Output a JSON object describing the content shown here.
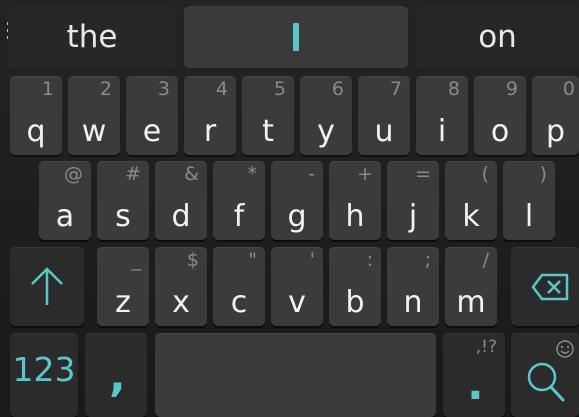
{
  "suggestions": {
    "left": "the",
    "middle": "I",
    "right": "on"
  },
  "rows": [
    {
      "keys": [
        {
          "main": "q",
          "hint": "1"
        },
        {
          "main": "w",
          "hint": "2"
        },
        {
          "main": "e",
          "hint": "3"
        },
        {
          "main": "r",
          "hint": "4"
        },
        {
          "main": "t",
          "hint": "5"
        },
        {
          "main": "y",
          "hint": "6"
        },
        {
          "main": "u",
          "hint": "7"
        },
        {
          "main": "i",
          "hint": "8"
        },
        {
          "main": "o",
          "hint": "9"
        },
        {
          "main": "p",
          "hint": "0"
        }
      ]
    },
    {
      "keys": [
        {
          "main": "a",
          "hint": "@"
        },
        {
          "main": "s",
          "hint": "#"
        },
        {
          "main": "d",
          "hint": "&"
        },
        {
          "main": "f",
          "hint": "*"
        },
        {
          "main": "g",
          "hint": "-"
        },
        {
          "main": "h",
          "hint": "+"
        },
        {
          "main": "j",
          "hint": "="
        },
        {
          "main": "k",
          "hint": "("
        },
        {
          "main": "l",
          "hint": ")"
        }
      ]
    },
    {
      "keys": [
        {
          "main": "z",
          "hint": "_"
        },
        {
          "main": "x",
          "hint": "$"
        },
        {
          "main": "c",
          "hint": "\""
        },
        {
          "main": "v",
          "hint": "'"
        },
        {
          "main": "b",
          "hint": ":"
        },
        {
          "main": "n",
          "hint": ";"
        },
        {
          "main": "m",
          "hint": "/"
        }
      ]
    }
  ],
  "bottom_row": {
    "symbols_label": "123",
    "comma_label": ",",
    "period_label": ".",
    "period_hint": ",!?",
    "emoji_icon": "smiley-icon",
    "search_icon": "search-icon"
  },
  "icons": {
    "menu": "menu-icon",
    "shift": "shift-arrow-icon",
    "backspace": "backspace-icon"
  },
  "colors": {
    "accent": "#5ac8c8",
    "key": "#3b3b3b",
    "key_dark": "#2b2b2b",
    "background": "#1c1c1c"
  }
}
